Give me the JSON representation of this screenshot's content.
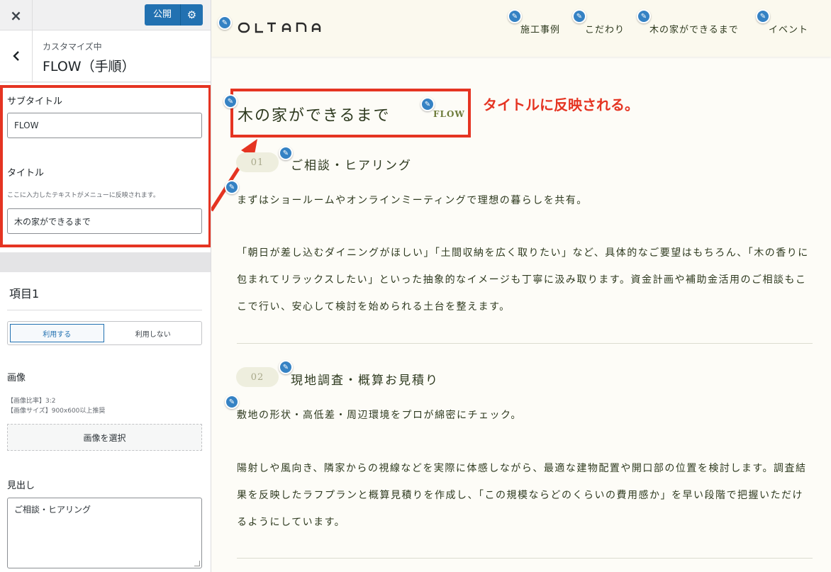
{
  "topbar": {
    "close_icon": "×",
    "publish_label": "公開",
    "gear_icon": "⚙"
  },
  "section": {
    "back_icon": "‹",
    "customizing_label": "カスタマイズ中",
    "title": "FLOW（手順）"
  },
  "controls": {
    "subtitle_label": "サブタイトル",
    "subtitle_value": "FLOW",
    "title_label": "タイトル",
    "title_desc": "ここに入力したテキストがメニューに反映されます。",
    "title_value": "木の家ができるまで"
  },
  "item1": {
    "label": "項目1",
    "use_on": "利用する",
    "use_off": "利用しない",
    "image_label": "画像",
    "image_note1": "【画像比率】3:2",
    "image_note2": "【画像サイズ】900x600以上推奨",
    "select_image": "画像を選択",
    "heading_label": "見出し",
    "heading_value": "ご相談・ヒアリング"
  },
  "site": {
    "logo": "OLTANA",
    "nav": [
      "施工事例",
      "こだわり",
      "木の家ができるまで",
      "イベント"
    ],
    "pencil_icon": "✎",
    "section_title": "木の家ができるまで",
    "section_sub": "FLOW",
    "annotation": "タイトルに反映される。",
    "steps": [
      {
        "num": "01",
        "title": "ご相談・ヒアリング",
        "p1": "まずはショールームやオンラインミーティングで理想の暮らしを共有。",
        "p2": "「朝日が差し込むダイニングがほしい」「土間収納を広く取りたい」など、具体的なご要望はもちろん、「木の香りに包まれてリラックスしたい」といった抽象的なイメージも丁寧に汲み取ります。資金計画や補助金活用のご相談もここで行い、安心して検討を始められる土台を整えます。"
      },
      {
        "num": "02",
        "title": "現地調査・概算お見積り",
        "p1": "敷地の形状・高低差・周辺環境をプロが綿密にチェック。",
        "p2": "陽射しや風向き、隣家からの視線などを実際に体感しながら、最適な建物配置や開口部の位置を検討します。調査結果を反映したラフプランと概算見積りを作成し、「この規模ならどのくらいの費用感か」を早い段階で把握いただけるようにしています。"
      }
    ]
  },
  "colors": {
    "accent": "#2271b1",
    "annotation_red": "#e53422",
    "text_green": "#2e3a1f"
  }
}
